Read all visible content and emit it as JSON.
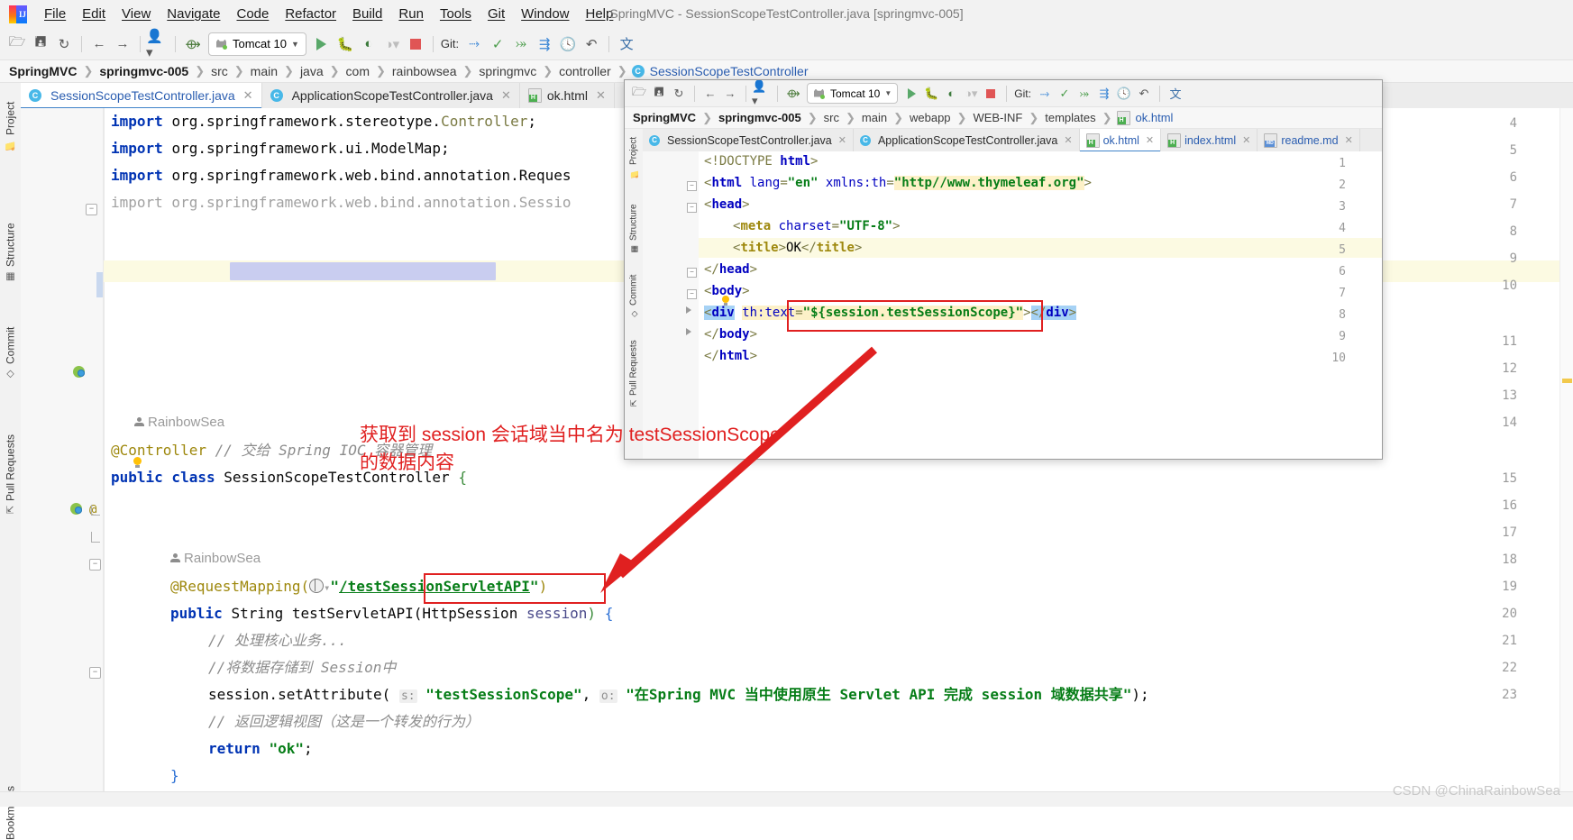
{
  "window": {
    "title": "SpringMVC - SessionScopeTestController.java [springmvc-005]"
  },
  "menubar": {
    "items": [
      "File",
      "Edit",
      "View",
      "Navigate",
      "Code",
      "Refactor",
      "Build",
      "Run",
      "Tools",
      "Git",
      "Window",
      "Help"
    ]
  },
  "toolbar": {
    "run_config": "Tomcat 10",
    "git_label": "Git:",
    "icons": [
      "open-folder-icon",
      "save-icon",
      "sync-icon",
      "back-arrow-icon",
      "forward-arrow-icon",
      "profile-icon",
      "undo-arrow-icon",
      "run-icon",
      "debug-icon",
      "run-with-coverage-icon",
      "profiler-icon",
      "stop-icon",
      "git-update-icon",
      "git-commit-icon",
      "git-push-icon",
      "git-rebase-icon",
      "history-icon",
      "rollback-icon",
      "translate-icon"
    ]
  },
  "breadcrumb": {
    "items": [
      {
        "label": "SpringMVC",
        "style": "bold"
      },
      {
        "label": "springmvc-005",
        "style": "bold"
      },
      {
        "label": "src",
        "style": "normal"
      },
      {
        "label": "main",
        "style": "normal"
      },
      {
        "label": "java",
        "style": "normal"
      },
      {
        "label": "com",
        "style": "normal"
      },
      {
        "label": "rainbowsea",
        "style": "normal"
      },
      {
        "label": "springmvc",
        "style": "normal"
      },
      {
        "label": "controller",
        "style": "normal"
      },
      {
        "label": "SessionScopeTestController",
        "style": "link"
      }
    ]
  },
  "rail": {
    "items": [
      "Project",
      "Structure",
      "Commit",
      "Pull Requests",
      "Bookmarks"
    ]
  },
  "editor_tabs": [
    {
      "label": "SessionScopeTestController.java",
      "icon": "java-class-icon",
      "active": true
    },
    {
      "label": "ApplicationScopeTestController.java",
      "icon": "java-class-icon",
      "active": false
    },
    {
      "label": "ok.html",
      "icon": "html-file-icon",
      "active": false
    }
  ],
  "editor": {
    "author_marker": "RainbowSea",
    "lines": [
      {
        "no": "4",
        "text": "import org.springframework.stereotype.Controller;"
      },
      {
        "no": "5",
        "text": "import org.springframework.ui.ModelMap;"
      },
      {
        "no": "6",
        "text": "import org.springframework.web.bind.annotation.Reques"
      },
      {
        "no": "7",
        "text": "import org.springframework.web.bind.annotation.Sessio"
      },
      {
        "no": "8",
        "text": ""
      },
      {
        "no": "9",
        "text": ""
      },
      {
        "no": "10",
        "text": ""
      },
      {
        "no": "11",
        "text": "@Controller // 交给 Spring IOC 容器管理"
      },
      {
        "no": "12",
        "text": "public class SessionScopeTestController {"
      },
      {
        "no": "13",
        "text": ""
      },
      {
        "no": "14",
        "text": ""
      },
      {
        "no": "15",
        "text": "@RequestMapping(\"/testSessionServletAPI\")"
      },
      {
        "no": "16",
        "text": "public String testServletAPI(HttpSession session) {"
      },
      {
        "no": "17",
        "text": "// 处理核心业务..."
      },
      {
        "no": "18",
        "text": "//将数据存储到 Session中"
      },
      {
        "no": "19",
        "text": "session.setAttribute( s: \"testSessionScope\", o: \"在Spring MVC 当中使用原生 Servlet API 完成 session 域数据共享\");"
      },
      {
        "no": "20",
        "text": "// 返回逻辑视图（这是一个转发的行为）"
      },
      {
        "no": "21",
        "text": "return \"ok\";"
      },
      {
        "no": "22",
        "text": "}"
      },
      {
        "no": "23",
        "text": ""
      }
    ],
    "param_hint_s": "s:",
    "param_hint_o": "o:",
    "mapping_path": "/testSessionServletAPI",
    "attr_key": "testSessionScope",
    "attr_value": "在Spring MVC 当中使用原生 Servlet API 完成 session 域数据共享",
    "return_value": "ok"
  },
  "float_window": {
    "toolbar": {
      "run_config": "Tomcat 10",
      "git_label": "Git:"
    },
    "breadcrumb": [
      {
        "label": "SpringMVC",
        "style": "bold"
      },
      {
        "label": "springmvc-005",
        "style": "bold"
      },
      {
        "label": "src",
        "style": "normal"
      },
      {
        "label": "main",
        "style": "normal"
      },
      {
        "label": "webapp",
        "style": "normal"
      },
      {
        "label": "WEB-INF",
        "style": "normal"
      },
      {
        "label": "templates",
        "style": "normal"
      },
      {
        "label": "ok.html",
        "style": "link"
      }
    ],
    "rail": [
      "Project",
      "Structure",
      "Commit",
      "Pull Requests"
    ],
    "tabs": [
      {
        "label": "SessionScopeTestController.java",
        "icon": "java-class-icon",
        "active": false
      },
      {
        "label": "ApplicationScopeTestController.java",
        "icon": "java-class-icon",
        "active": false
      },
      {
        "label": "ok.html",
        "icon": "html-file-icon",
        "active": true
      },
      {
        "label": "index.html",
        "icon": "html-file-icon",
        "active": false
      },
      {
        "label": "readme.md",
        "icon": "markdown-file-icon",
        "active": false
      }
    ],
    "lines": [
      {
        "no": "1",
        "text": "<!DOCTYPE html>"
      },
      {
        "no": "2",
        "text": "<html lang=\"en\" xmlns:th=\"http//www.thymeleaf.org\">"
      },
      {
        "no": "3",
        "text": "<head>"
      },
      {
        "no": "4",
        "text": "    <meta charset=\"UTF-8\">"
      },
      {
        "no": "5",
        "text": "    <title>OK</title>"
      },
      {
        "no": "6",
        "text": "</head>"
      },
      {
        "no": "7",
        "text": "<body>"
      },
      {
        "no": "8",
        "text": "<div th:text=\"${session.testSessionScope}\"></div>"
      },
      {
        "no": "9",
        "text": "</body>"
      },
      {
        "no": "10",
        "text": "</html>"
      }
    ],
    "thymeleaf_ns": "http//www.thymeleaf.org",
    "page_title_text": "OK",
    "th_expression": "${session.testSessionScope}"
  },
  "annotation": {
    "text": "获取到 session 会话域当中名为 testSessionScope\n的数据内容",
    "color": "#e02020",
    "arrow": "red-arrow-pointing-to-testSessionScope"
  },
  "watermark": "CSDN @ChinaRainbowSea",
  "colors": {
    "keyword": "#0033b3",
    "string": "#067d17",
    "annotation": "#9e880d",
    "comment": "#8c8c8c",
    "accent": "#4083c9",
    "red": "#e02020"
  }
}
